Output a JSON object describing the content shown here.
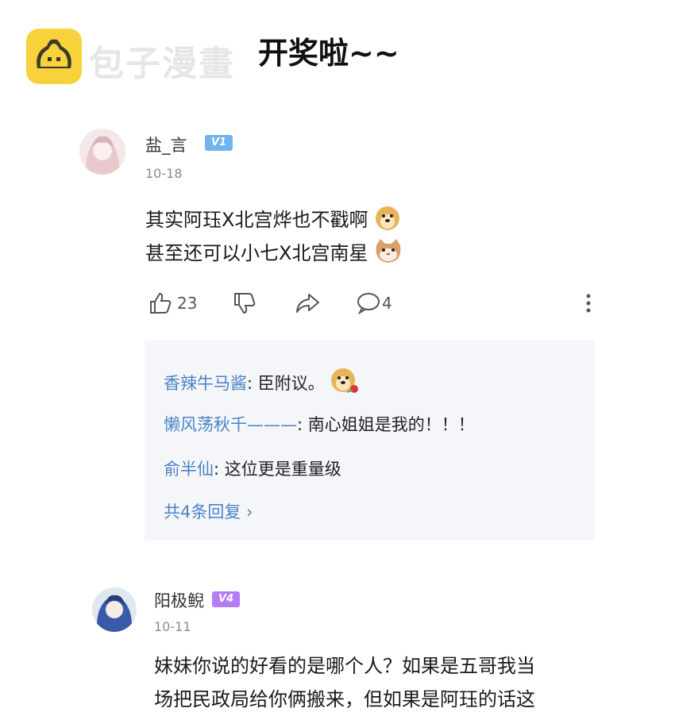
{
  "header": {
    "logo_text": "包子漫畫",
    "title": "开奖啦~~"
  },
  "comments": [
    {
      "username": "盐_言",
      "level": "V1",
      "level_color": "#6fb4ec",
      "date": "10-18",
      "lines": [
        "其实阿珏X北宫烨也不戳啊",
        "甚至还可以小七X北宫南星"
      ],
      "likes": "23",
      "replies_count": "4",
      "replies": [
        {
          "author": "香辣牛马酱",
          "text": ": 臣附议。"
        },
        {
          "author": "懒风荡秋千———",
          "text": ": 南心姐姐是我的！！！"
        },
        {
          "author": "俞半仙",
          "text": ": 这位更是重量级"
        }
      ],
      "more_replies": "共4条回复 ›"
    },
    {
      "username": "阳极鲵",
      "level": "V4",
      "level_color": "#b57cf3",
      "date": "10-11",
      "lines": [
        "妹妹你说的好看的是哪个人？如果是五哥我当",
        "场把民政局给你俩搬来，但如果是阿珏的话这"
      ]
    }
  ]
}
